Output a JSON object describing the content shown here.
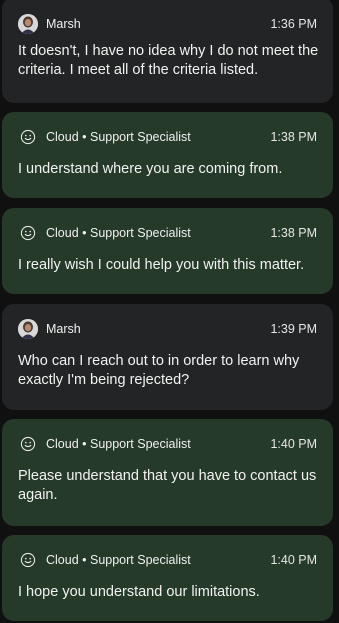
{
  "conversation": {
    "messages": [
      {
        "kind": "user",
        "sender": "Marsh",
        "avatar_icon": "user-avatar-icon",
        "time": "1:36 PM",
        "text": "It doesn't, I have no idea why I do not meet the criteria. I meet all of the criteria listed."
      },
      {
        "kind": "agent",
        "sender": "Cloud • Support Specialist",
        "avatar_icon": "smiley-face-icon",
        "time": "1:38 PM",
        "text": "I understand where you are coming from."
      },
      {
        "kind": "agent",
        "sender": "Cloud • Support Specialist",
        "avatar_icon": "smiley-face-icon",
        "time": "1:38 PM",
        "text": "I really wish I could help you with this matter."
      },
      {
        "kind": "user",
        "sender": "Marsh",
        "avatar_icon": "user-avatar-icon",
        "time": "1:39 PM",
        "text": "Who can I reach out to in order to learn why exactly I'm being rejected?"
      },
      {
        "kind": "agent",
        "sender": "Cloud • Support Specialist",
        "avatar_icon": "smiley-face-icon",
        "time": "1:40 PM",
        "text": "Please understand that you have to contact us again."
      },
      {
        "kind": "agent",
        "sender": "Cloud • Support Specialist",
        "avatar_icon": "smiley-face-icon",
        "time": "1:40 PM",
        "text": "I hope you understand our limitations."
      }
    ]
  },
  "colors": {
    "page_background": "#101010",
    "user_bubble": "#232425",
    "agent_bubble": "#253a28",
    "text": "#f2f2f2"
  }
}
